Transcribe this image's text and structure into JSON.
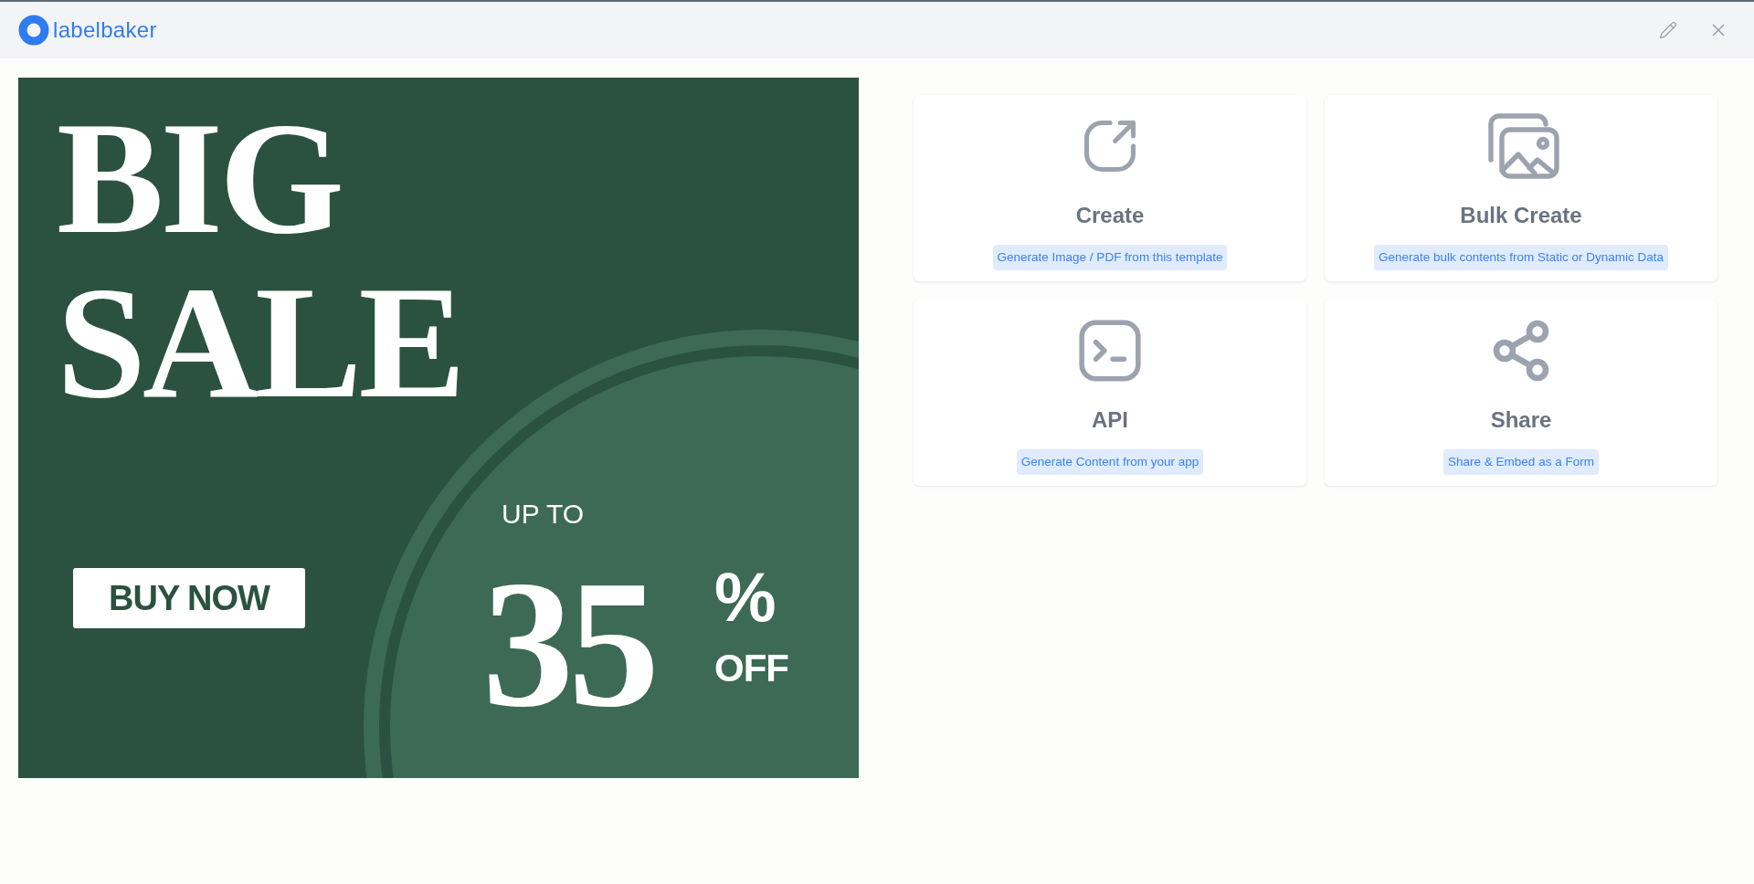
{
  "header": {
    "logo_text": "labelbaker"
  },
  "template": {
    "headline": [
      "BIG",
      "SALE"
    ],
    "button": "BUY NOW",
    "discount_prefix": "UP TO",
    "discount_value": "35",
    "discount_unit": "%",
    "discount_suffix": "OFF"
  },
  "actions": [
    {
      "title": "Create",
      "description": "Generate Image / PDF from this template"
    },
    {
      "title": "Bulk Create",
      "description": "Generate bulk contents from Static or Dynamic Data"
    },
    {
      "title": "API",
      "description": "Generate Content from your app"
    },
    {
      "title": "Share",
      "description": "Share & Embed as a Form"
    }
  ]
}
